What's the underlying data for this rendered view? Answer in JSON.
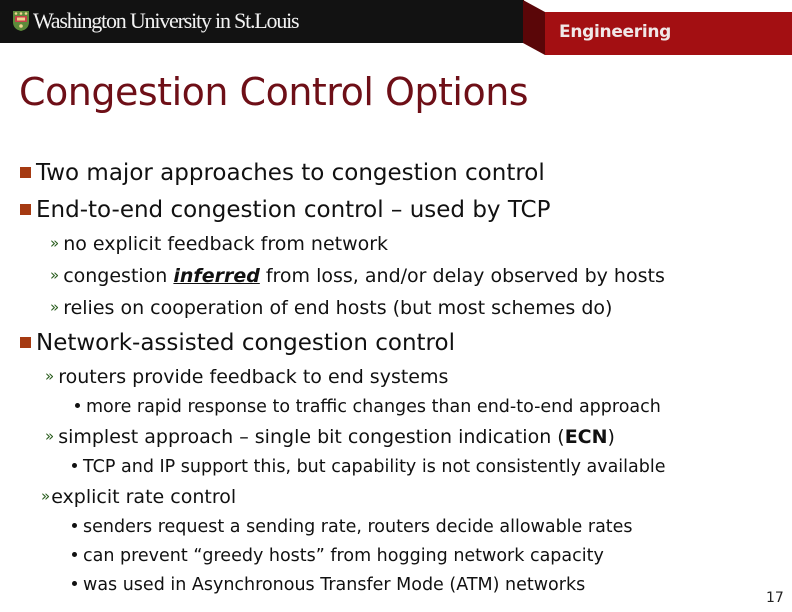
{
  "header": {
    "university": "Washington University in St.Louis",
    "school": "Engineering",
    "logo_icon": "university-shield-icon",
    "colors": {
      "header_black": "#121212",
      "header_red": "#a30f12",
      "header_red_dark": "#5a0608"
    }
  },
  "slide": {
    "title": "Congestion Control Options",
    "title_color": "#6e0f17",
    "bullets": [
      {
        "level": 1,
        "text": "Two major approaches to congestion control"
      },
      {
        "level": 1,
        "text": "End-to-end congestion control – used by TCP"
      },
      {
        "level": 2,
        "text": "no explicit feedback from network"
      },
      {
        "level": 2,
        "prefix": "congestion ",
        "emph": "inferred",
        "suffix": " from loss, and/or delay observed by hosts"
      },
      {
        "level": 2,
        "text": "relies on cooperation of end hosts (but most schemes do)"
      },
      {
        "level": 1,
        "text": "Network-assisted congestion control"
      },
      {
        "level": 2,
        "text": "routers provide feedback to end systems"
      },
      {
        "level": 3,
        "text": "more rapid response to traffic changes than end-to-end approach"
      },
      {
        "level": 2,
        "prefix": "simplest approach – single bit congestion indication (",
        "emph": "ECN",
        "suffix": ")"
      },
      {
        "level": 3,
        "text": "TCP and IP support this, but capability is not consistently available"
      },
      {
        "level": 2,
        "text": "explicit rate control"
      },
      {
        "level": 3,
        "text": "senders request a sending rate, routers decide allowable rates"
      },
      {
        "level": 3,
        "text": "can prevent “greedy hosts” from hogging network capacity"
      },
      {
        "level": 3,
        "text": "was used in Asynchronous Transfer Mode (ATM) networks"
      }
    ],
    "bullet_colors": {
      "level1": "#a53a12",
      "level2": "#2a5d1e",
      "level3": "#111111"
    },
    "page_number": "17"
  }
}
